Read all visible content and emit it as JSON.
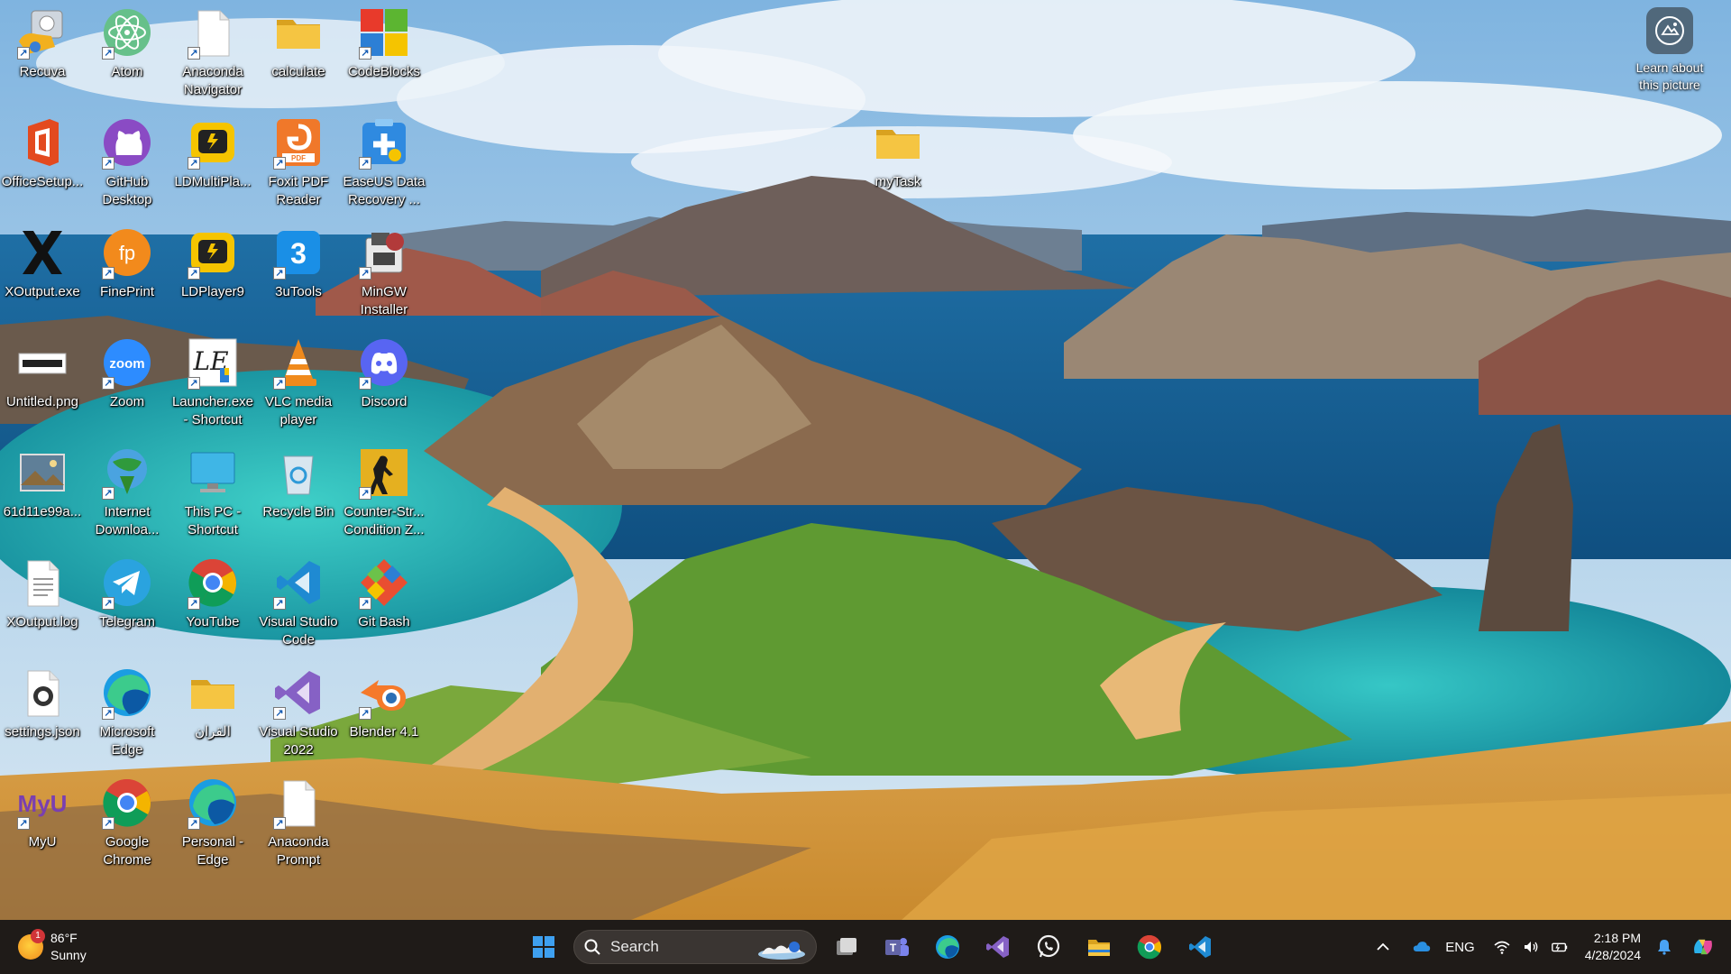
{
  "desktop": {
    "icons": [
      {
        "label": "Recuva",
        "icon": "recuva-icon",
        "color": "#f2b01e"
      },
      {
        "label": "Atom",
        "icon": "atom-icon",
        "color": "#66c08a"
      },
      {
        "label": "Anaconda Navigator",
        "icon": "blank-file-icon",
        "color": "#ffffff"
      },
      {
        "label": "calculate",
        "icon": "folder-icon",
        "color": "#f5c542"
      },
      {
        "label": "CodeBlocks",
        "icon": "codeblocks-icon",
        "color": "#e83a2b"
      },
      {
        "label": "OfficeSetup...",
        "icon": "office-icon",
        "color": "#e34a1f"
      },
      {
        "label": "GitHub Desktop",
        "icon": "github-icon",
        "color": "#8a4bc4"
      },
      {
        "label": "LDMultiPla...",
        "icon": "ldmultiplayer-icon",
        "color": "#f5c400"
      },
      {
        "label": "Foxit PDF Reader",
        "icon": "foxit-icon",
        "color": "#f0782a"
      },
      {
        "label": "EaseUS Data Recovery ...",
        "icon": "easeus-icon",
        "color": "#2f8ae0"
      },
      {
        "label": "XOutput.exe",
        "icon": "xoutput-icon",
        "color": "#111111"
      },
      {
        "label": "FinePrint",
        "icon": "fineprint-icon",
        "color": "#f28a1c"
      },
      {
        "label": "LDPlayer9",
        "icon": "ldplayer-icon",
        "color": "#f5c400"
      },
      {
        "label": "3uTools",
        "icon": "3utools-icon",
        "color": "#1a8fe6"
      },
      {
        "label": "MinGW Installer",
        "icon": "mingw-icon",
        "color": "#b23a3a"
      },
      {
        "label": "Untitled.png",
        "icon": "image-file-icon",
        "color": "#ffffff"
      },
      {
        "label": "Zoom",
        "icon": "zoom-icon",
        "color": "#2d8cff"
      },
      {
        "label": "Launcher.exe - Shortcut",
        "icon": "launcher-icon",
        "color": "#ffffff"
      },
      {
        "label": "VLC media player",
        "icon": "vlc-icon",
        "color": "#f08a1c"
      },
      {
        "label": "Discord",
        "icon": "discord-icon",
        "color": "#5865f2"
      },
      {
        "label": "61d11e99a...",
        "icon": "photo-file-icon",
        "color": "#6a8fb0"
      },
      {
        "label": "Internet Downloa...",
        "icon": "idm-icon",
        "color": "#2f9a3c"
      },
      {
        "label": "This PC - Shortcut",
        "icon": "this-pc-icon",
        "color": "#3fb6e6"
      },
      {
        "label": "Recycle Bin",
        "icon": "recycle-bin-icon",
        "color": "#d8e6f0"
      },
      {
        "label": "Counter-Str... Condition Z...",
        "icon": "counter-strike-icon",
        "color": "#e5b020"
      },
      {
        "label": "XOutput.log",
        "icon": "text-file-icon",
        "color": "#ffffff"
      },
      {
        "label": "Telegram",
        "icon": "telegram-icon",
        "color": "#2aa3df"
      },
      {
        "label": "YouTube",
        "icon": "chrome-icon",
        "color": "#dd4b39"
      },
      {
        "label": "Visual Studio Code",
        "icon": "vscode-icon",
        "color": "#1f8ad2"
      },
      {
        "label": "Git Bash",
        "icon": "git-bash-icon",
        "color": "#e94e31"
      },
      {
        "label": "settings.json",
        "icon": "json-file-icon",
        "color": "#ffffff"
      },
      {
        "label": "Microsoft Edge",
        "icon": "edge-icon",
        "color": "#1b9de2"
      },
      {
        "label": "القران",
        "icon": "folder-icon",
        "color": "#f5c542"
      },
      {
        "label": "Visual Studio 2022",
        "icon": "visual-studio-icon",
        "color": "#8661c5"
      },
      {
        "label": "Blender 4.1",
        "icon": "blender-icon",
        "color": "#f5792a"
      },
      {
        "label": "MyU",
        "icon": "myu-icon",
        "color": "#7a3fb0"
      },
      {
        "label": "Google Chrome",
        "icon": "chrome-icon",
        "color": "#dd4b39"
      },
      {
        "label": "Personal - Edge",
        "icon": "edge-icon",
        "color": "#1b9de2"
      },
      {
        "label": "Anaconda Prompt",
        "icon": "blank-file-icon",
        "color": "#ffffff"
      },
      {
        "label": "myTask",
        "icon": "folder-icon",
        "color": "#f5c542"
      }
    ]
  },
  "learn": {
    "label": "Learn about this picture",
    "icon": "camera-icon"
  },
  "taskbar": {
    "weather": {
      "temp": "86°F",
      "condition": "Sunny",
      "badge": "1",
      "icon": "sun-icon"
    },
    "search": {
      "placeholder": "Search"
    },
    "apps": [
      {
        "name": "start-button",
        "icon": "windows-icon",
        "color": "#3ea0f0"
      },
      {
        "name": "task-view-button",
        "icon": "task-view-icon",
        "color": "#d9d9d9"
      },
      {
        "name": "teams-button",
        "icon": "teams-icon",
        "color": "#6264a7"
      },
      {
        "name": "edge-button",
        "icon": "edge-icon",
        "color": "#1b9de2"
      },
      {
        "name": "visual-studio-button",
        "icon": "visual-studio-icon",
        "color": "#8661c5"
      },
      {
        "name": "whatsapp-button",
        "icon": "whatsapp-icon",
        "color": "#f2f2f2"
      },
      {
        "name": "file-explorer-button",
        "icon": "folder-icon",
        "color": "#f5c542"
      },
      {
        "name": "chrome-button",
        "icon": "chrome-icon",
        "color": "#dd4b39"
      },
      {
        "name": "vscode-button",
        "icon": "vscode-icon",
        "color": "#1f8ad2"
      }
    ],
    "tray": {
      "language": "ENG",
      "time": "2:18 PM",
      "date": "4/28/2024"
    }
  }
}
